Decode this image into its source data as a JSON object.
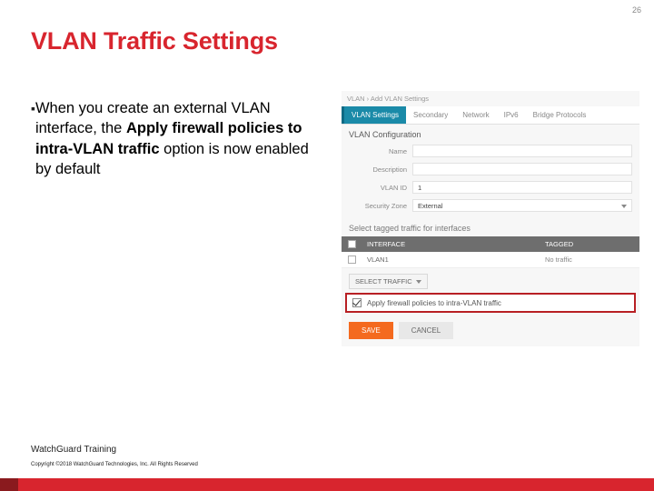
{
  "page_number": "26",
  "title": "VLAN Traffic Settings",
  "bullet": {
    "pre": "When you create an external VLAN interface, the ",
    "bold": "Apply firewall policies to intra-VLAN traffic",
    "post": " option is now enabled by default"
  },
  "ui": {
    "crumbs": "VLAN  ›  Add VLAN Settings",
    "tabs": {
      "active": "VLAN Settings",
      "t1": "Secondary",
      "t2": "Network",
      "t3": "IPv6",
      "t4": "Bridge Protocols"
    },
    "section_title": "VLAN Configuration",
    "fields": {
      "name_label": "Name",
      "name_value": "",
      "desc_label": "Description",
      "desc_value": "",
      "vlanid_label": "VLAN ID",
      "vlanid_value": "1",
      "zone_label": "Security Zone",
      "zone_value": "External"
    },
    "sub_title": "Select tagged traffic for interfaces",
    "table": {
      "col_interface": "INTERFACE",
      "col_tagged": "TAGGED",
      "row1_iface": "VLAN1",
      "row1_tagged": "No traffic"
    },
    "select_traffic": "SELECT TRAFFIC",
    "apply_label": "Apply firewall policies to intra-VLAN traffic",
    "save": "SAVE",
    "cancel": "CANCEL"
  },
  "footer": "WatchGuard Training",
  "copyright": "Copyright ©2018 WatchGuard Technologies, Inc. All Rights Reserved"
}
